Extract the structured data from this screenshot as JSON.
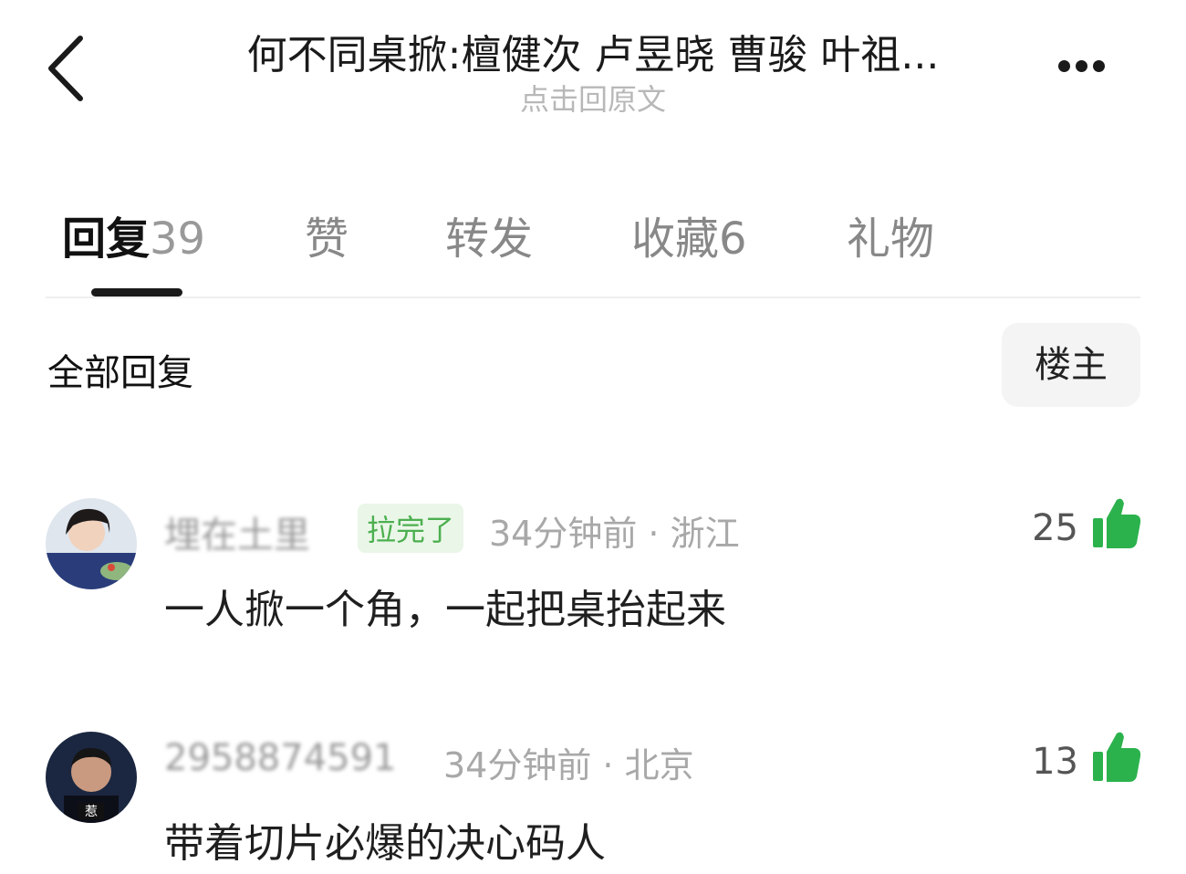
{
  "header": {
    "title": "何不同桌掀:檀健次 卢昱晓 曹骏 叶祖...",
    "subtitle": "点击回原文"
  },
  "tabs": [
    {
      "label": "回复",
      "count": "39"
    },
    {
      "label": "赞",
      "count": ""
    },
    {
      "label": "转发",
      "count": ""
    },
    {
      "label": "收藏",
      "count": "6"
    },
    {
      "label": "礼物",
      "count": ""
    }
  ],
  "section": {
    "title": "全部回复",
    "filter_label": "楼主"
  },
  "comments": [
    {
      "username": "埋在土里",
      "badge": "拉完了",
      "time_location": "34分钟前 · 浙江",
      "content": "一人掀一个角，一起把桌抬起来",
      "likes": "25"
    },
    {
      "username": "2958874591",
      "badge": "",
      "time_location": "34分钟前 · 北京",
      "content": "带着切片必爆的决心码人",
      "likes": "13"
    }
  ],
  "colors": {
    "accent_green": "#2bb24c",
    "badge_text": "#4caf50",
    "badge_bg": "#eaf7e8"
  },
  "icons": {
    "back": "chevron-left-icon",
    "more": "more-dots-icon",
    "like": "thumbs-up-icon"
  }
}
